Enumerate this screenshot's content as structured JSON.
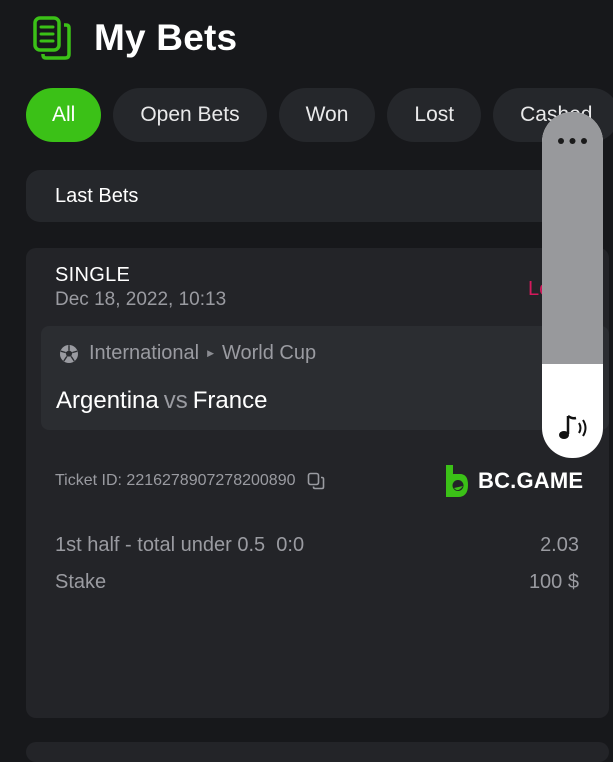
{
  "header": {
    "title": "My Bets",
    "icon": "document-list-icon",
    "icon_color": "#3bc117"
  },
  "filters": [
    {
      "label": "All",
      "active": true
    },
    {
      "label": "Open Bets",
      "active": false
    },
    {
      "label": "Won",
      "active": false
    },
    {
      "label": "Lost",
      "active": false
    },
    {
      "label": "Cashed",
      "active": false
    }
  ],
  "section": {
    "label": "Last Bets"
  },
  "bet": {
    "type": "SINGLE",
    "datetime": "Dec 18, 2022, 10:13",
    "status": "Lost",
    "status_color": "#d4195c",
    "league": "International",
    "tournament": "World Cup",
    "team_home": "Argentina",
    "vs": "vs",
    "team_away": "France",
    "ticket_label": "Ticket ID: 2216278907278200890",
    "brand": "BC.GAME",
    "selection": "1st half - total under 0.5",
    "selection_score": "0:0",
    "odds": "2.03",
    "stake_label": "Stake",
    "stake_value": "100 $"
  },
  "overlay": {
    "more_icon": "more-dots-icon",
    "sound_icon": "sound-icon"
  },
  "colors": {
    "accent": "#3bc117",
    "background": "#17181b",
    "card": "#232428",
    "lost": "#d4195c"
  }
}
